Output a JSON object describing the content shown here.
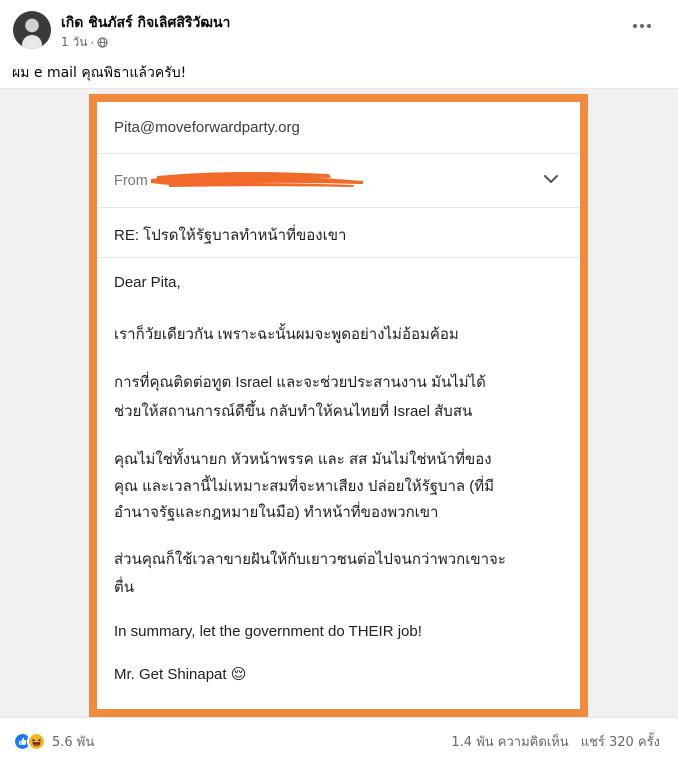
{
  "post": {
    "author": "เกิด ชินภัสร์ กิจเลิศสิริวัฒนา",
    "time": "1 วัน",
    "separator": "·",
    "text": "ผม e mail คุณพิธาแล้วครับ!",
    "more_icon": "more-horizontal-icon",
    "privacy_icon": "globe-icon"
  },
  "email": {
    "to": "Pita@moveforwardparty.org",
    "from_label": "From",
    "subject": "RE: โปรดให้รัฐบาลทำหน้าที่ของเขา",
    "body_lines": [
      "Dear Pita,",
      "เราก็วัยเดียวกัน เพราะฉะนั้นผมจะพูดอย่างไม่อ้อมค้อม",
      "การที่คุณติดต่อทูต Israel และจะช่วยประสานงาน มันไม่ได้",
      "ช่วยให้สถานการณ์ดีขึ้น กลับทำให้คนไทยที่ Israel สับสน",
      "คุณไม่ใช่ทั้งนายก หัวหน้าพรรค และ สส มันไม่ใช่หน้าที่ของ",
      "คุณ และเวลานี้ไม่เหมาะสมที่จะหาเสียง ปล่อยให้รัฐบาล (ที่มี",
      "อำนาจรัฐและกฎหมายในมือ) ทำหน้าที่ของพวกเขา",
      "ส่วนคุณก็ใช้เวลาขายฝันให้กับเยาวชนต่อไปจนกว่าพวกเขาจะ",
      "ตื่น",
      "In summary, let the government do THEIR job!",
      "Mr. Get Shinapat 😌"
    ],
    "frame_color": "#f08a3c",
    "redaction_color": "#f26a2a"
  },
  "stats": {
    "reaction_count": "5.6 พัน",
    "comments": "1.4 พัน ความคิดเห็น",
    "shares": "แชร์ 320 ครั้ง",
    "reaction_icons": [
      "like-icon",
      "haha-icon"
    ]
  }
}
